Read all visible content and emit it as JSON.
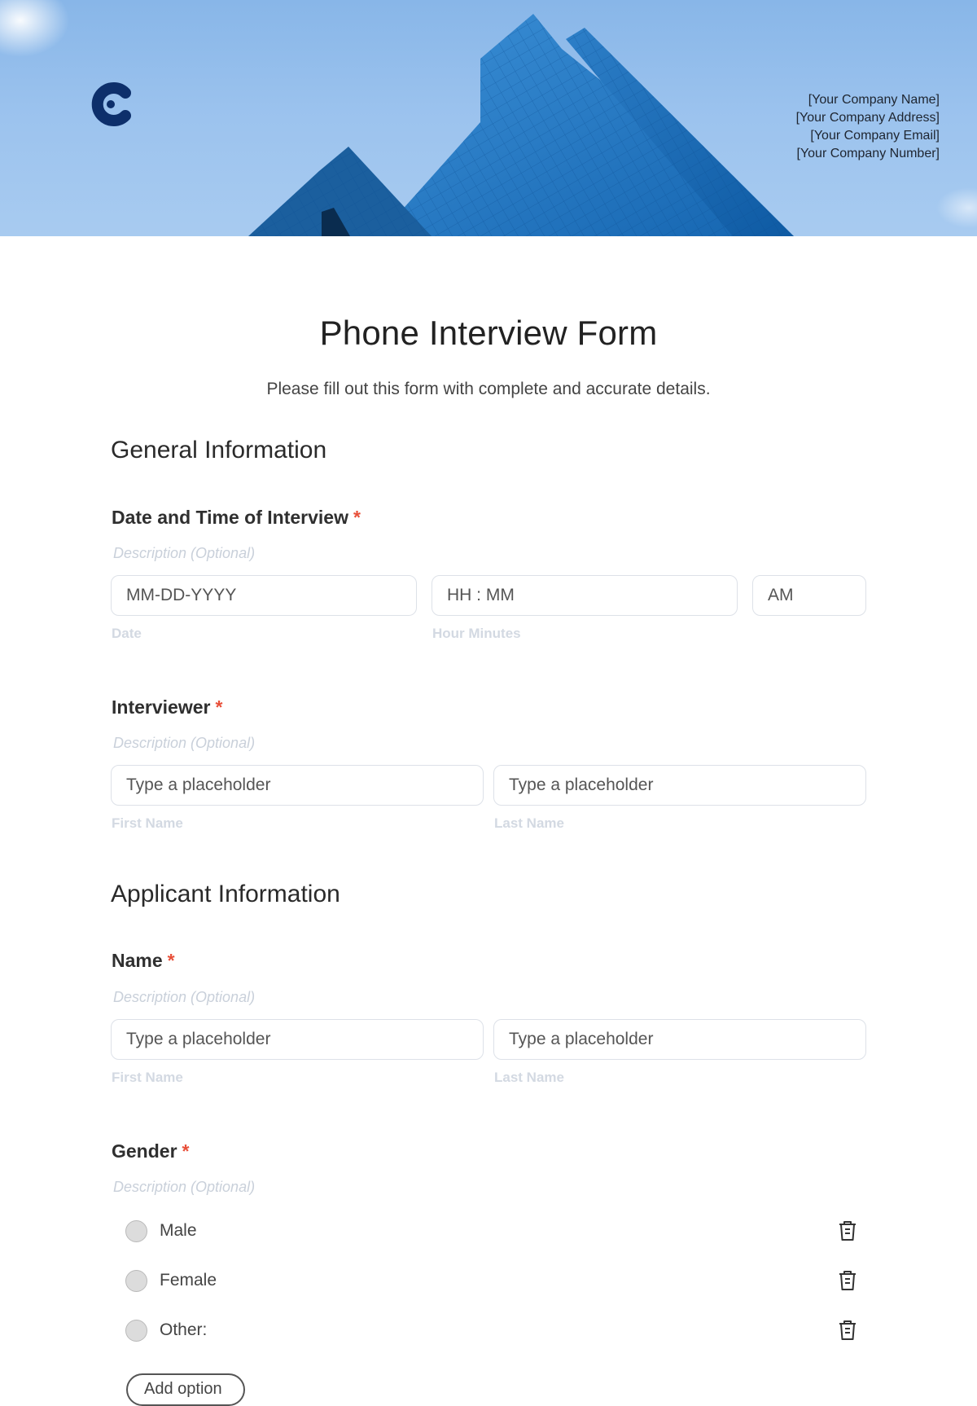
{
  "header": {
    "logo": "company-logo-c",
    "company_info": [
      "[Your Company Name]",
      "[Your Company Address]",
      "[Your Company Email]",
      "[Your Company Number]"
    ]
  },
  "form": {
    "title": "Phone Interview Form",
    "subtitle": "Please fill out this form with complete and accurate details.",
    "required_marker": "*",
    "description_placeholder": "Description (Optional)",
    "sections": {
      "general": {
        "title": "General Information",
        "date_time": {
          "label": "Date and Time of Interview",
          "description": "Description (Optional)",
          "date_placeholder": "MM-DD-YYYY",
          "date_sublabel": "Date",
          "time_placeholder": "HH : MM",
          "time_sublabel": "Hour Minutes",
          "ampm_value": "AM"
        },
        "interviewer": {
          "label": "Interviewer",
          "description": "Description (Optional)",
          "first_placeholder": "Type a placeholder",
          "first_sublabel": "First Name",
          "last_placeholder": "Type a placeholder",
          "last_sublabel": "Last Name"
        }
      },
      "applicant": {
        "title": "Applicant Information",
        "name": {
          "label": "Name",
          "description": "Description (Optional)",
          "first_placeholder": "Type a placeholder",
          "first_sublabel": "First Name",
          "last_placeholder": "Type a placeholder",
          "last_sublabel": "Last Name"
        },
        "gender": {
          "label": "Gender",
          "description": "Description (Optional)",
          "options": [
            {
              "label": "Male",
              "icon": "trash-icon"
            },
            {
              "label": "Female",
              "icon": "trash-icon"
            },
            {
              "label": "Other:",
              "icon": "trash-icon"
            }
          ],
          "add_button": "Add option"
        }
      }
    }
  },
  "colors": {
    "required": "#e8503a",
    "logo": "#0d2f6b",
    "sky": "#9cc3ee",
    "building": "#1f78c8"
  }
}
